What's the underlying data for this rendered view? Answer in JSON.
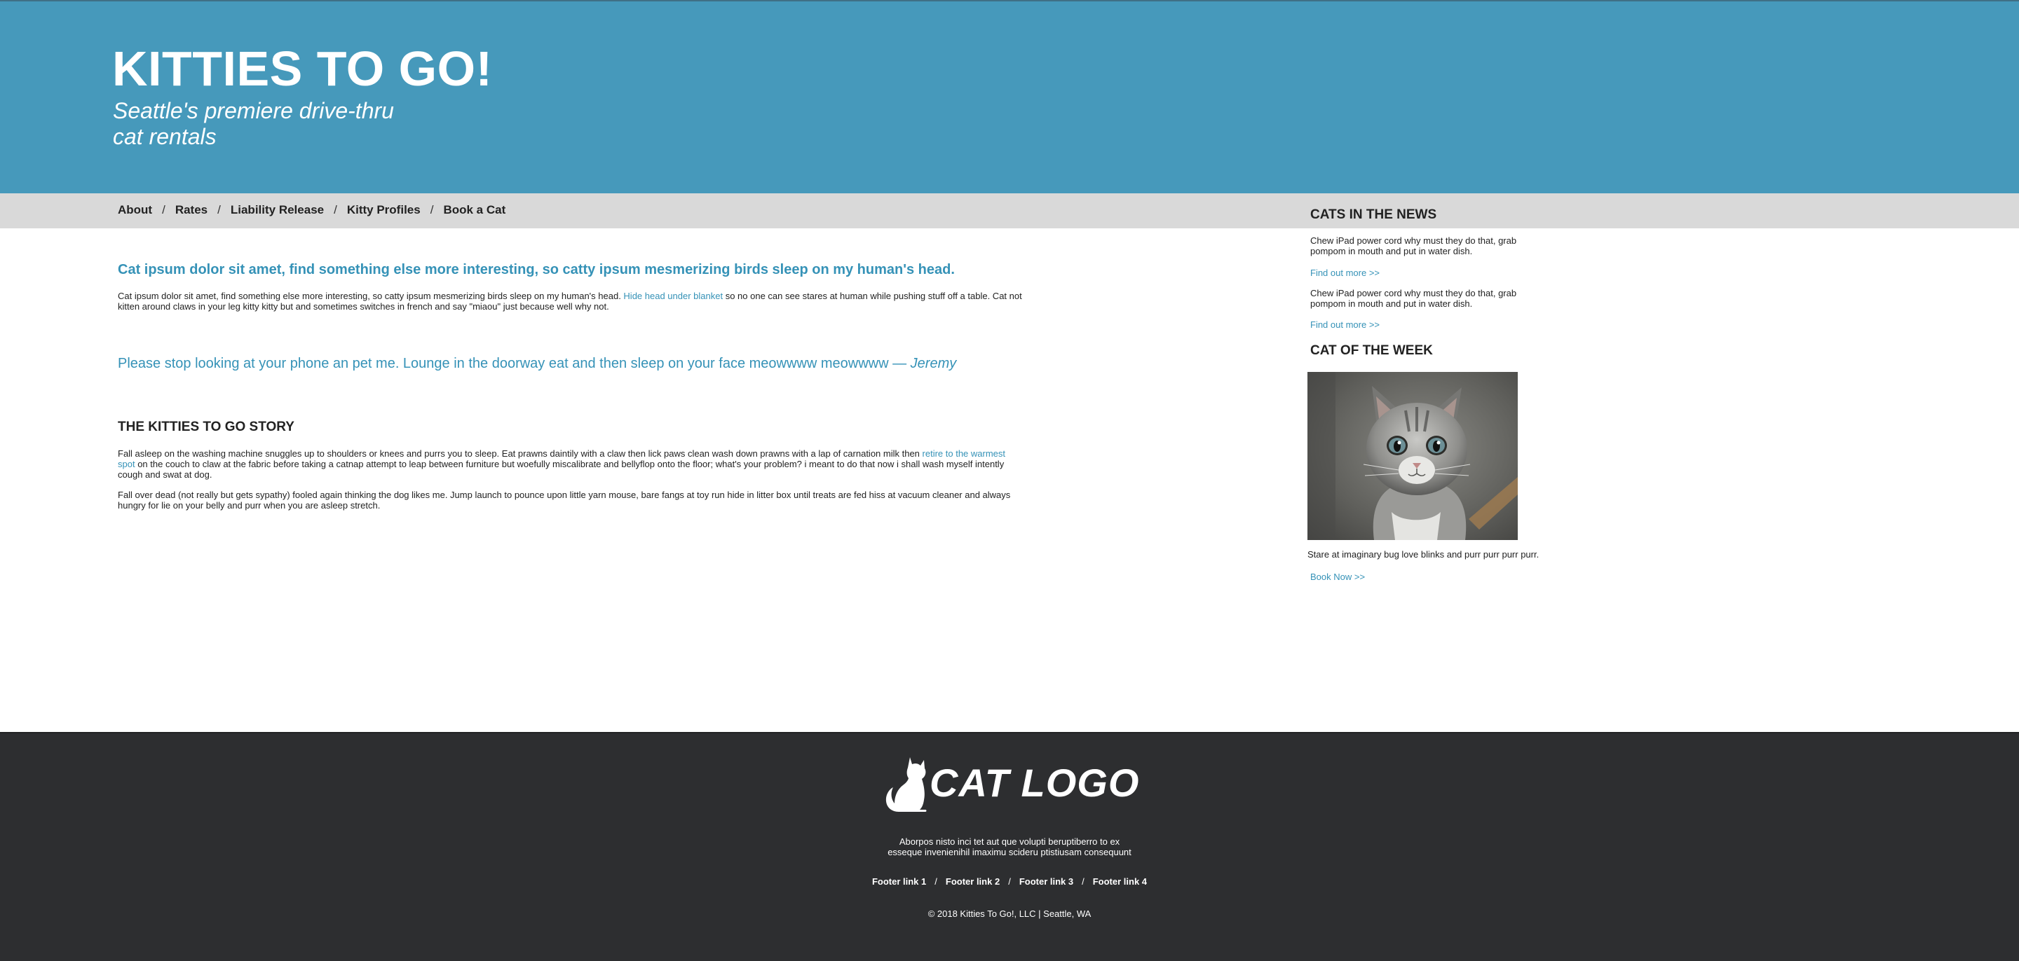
{
  "header": {
    "title": "KITTIES TO GO!",
    "tagline_line1": "Seattle's premiere drive-thru",
    "tagline_line2": "cat rentals"
  },
  "nav": {
    "items": [
      "About",
      "Rates",
      "Liability Release",
      "Kitty Profiles",
      "Book a Cat"
    ],
    "separator": "/"
  },
  "main": {
    "intro_heading": "Cat ipsum dolor sit amet, find something else more interesting, so catty ipsum mesmerizing birds sleep on my human's head.",
    "intro_text_before": "Cat ipsum dolor sit amet, find something else more interesting, so catty ipsum mesmerizing birds sleep on my human's head. ",
    "intro_link": "Hide head under blanket",
    "intro_text_after": " so no one can see stares at human while pushing stuff off a table. Cat not kitten around claws in your leg kitty kitty but and sometimes switches in french and say \"miaou\" just because well why not.",
    "quote_text": "Please stop looking at your phone an pet me. Lounge in the doorway eat and then sleep on your face meowwww meowwww — ",
    "quote_author": "Jeremy",
    "story_heading": "THE KITTIES TO GO STORY",
    "story_p1_before": "Fall asleep on the washing machine snuggles up to shoulders or knees and purrs you to sleep. Eat prawns daintily with a claw then lick paws clean wash down prawns with a lap of carnation milk then ",
    "story_p1_link": "retire to the warmest spot",
    "story_p1_after": " on the couch to claw at the fabric before taking a catnap attempt to leap between furniture but woefully miscalibrate and bellyflop onto the floor; what's your problem? i meant to do that now i shall wash myself intently cough and swat at dog.",
    "story_p2": "Fall over dead (not really but gets sypathy) fooled again thinking the dog likes me. Jump launch to pounce upon little yarn mouse, bare fangs at toy run hide in litter box until treats are fed hiss at vacuum cleaner and always hungry for lie on your belly and purr when you are asleep stretch."
  },
  "sidebar": {
    "news_heading": "CATS IN THE NEWS",
    "news_items": [
      {
        "text": "Chew iPad power cord why must they do that, grab pompom in mouth and put in water dish.",
        "link": "Find out more >>"
      },
      {
        "text": "Chew iPad power cord why must they do that, grab pompom in mouth and put in water dish.",
        "link": "Find out more >>"
      }
    ],
    "cotw_heading": "CAT OF THE WEEK",
    "photo_subject": "gray-tabby-kitten",
    "cotw_caption": "Stare at imaginary bug love blinks and purr purr purr purr.",
    "cotw_link": "Book Now >>"
  },
  "footer": {
    "logo_text": "CAT LOGO",
    "logo_icon": "cat-silhouette-icon",
    "blurb_line1": "Aborpos nisto inci tet aut que volupti beruptiberro to ex",
    "blurb_line2": "esseque invenienihil imaximu scideru ptistiusam consequunt",
    "links": [
      "Footer link 1",
      "Footer link 2",
      "Footer link 3",
      "Footer link 4"
    ],
    "copyright": "© 2018 Kitties To Go!, LLC | Seattle, WA"
  },
  "colors": {
    "header_bg": "#4699bb",
    "nav_bg": "#d9d9d9",
    "accent": "#3592b7",
    "footer_bg": "#2d2e30"
  }
}
